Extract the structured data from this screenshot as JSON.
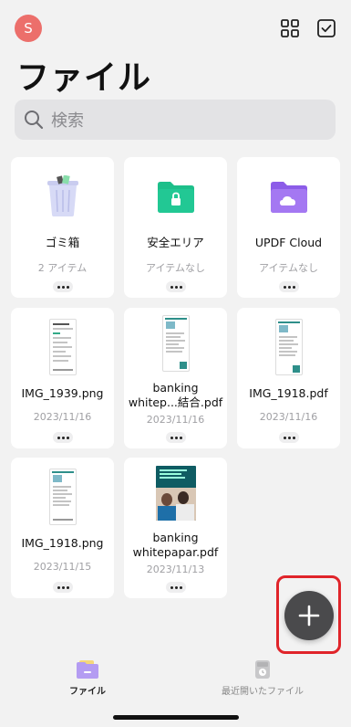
{
  "header": {
    "avatar_initial": "S",
    "title": "ファイル",
    "grid_view_icon": "grid-icon",
    "select_icon": "checkbox-icon"
  },
  "search": {
    "placeholder": "検索",
    "icon": "search-icon"
  },
  "items": [
    {
      "name": "ゴミ箱",
      "meta": "2 アイテム",
      "icon": "trash-icon"
    },
    {
      "name": "安全エリア",
      "meta": "アイテムなし",
      "icon": "secure-folder-icon"
    },
    {
      "name": "UPDF Cloud",
      "meta": "アイテムなし",
      "icon": "cloud-folder-icon"
    },
    {
      "name": "IMG_1939.png",
      "meta": "2023/11/16",
      "icon": "screenshot-thumbnail"
    },
    {
      "name": "banking whitep...結合.pdf",
      "meta": "2023/11/16",
      "icon": "pdf-thumbnail"
    },
    {
      "name": "IMG_1918.pdf",
      "meta": "2023/11/16",
      "icon": "pdf-thumbnail"
    },
    {
      "name": "IMG_1918.png",
      "meta": "2023/11/15",
      "icon": "screenshot-thumbnail"
    },
    {
      "name": "banking whitepapar.pdf",
      "meta": "2023/11/13",
      "icon": "pdf-cover-thumbnail"
    }
  ],
  "fab": {
    "icon": "plus-icon"
  },
  "tabs": [
    {
      "label": "ファイル",
      "icon": "folder-tab-icon",
      "active": true
    },
    {
      "label": "最近開いたファイル",
      "icon": "recent-files-icon",
      "active": false
    }
  ],
  "colors": {
    "avatar": "#ec6f6b",
    "secure_folder": "#1dbf8a",
    "cloud_folder": "#9b6cf0",
    "fab": "#4a4a4c",
    "highlight": "#e0242a"
  }
}
